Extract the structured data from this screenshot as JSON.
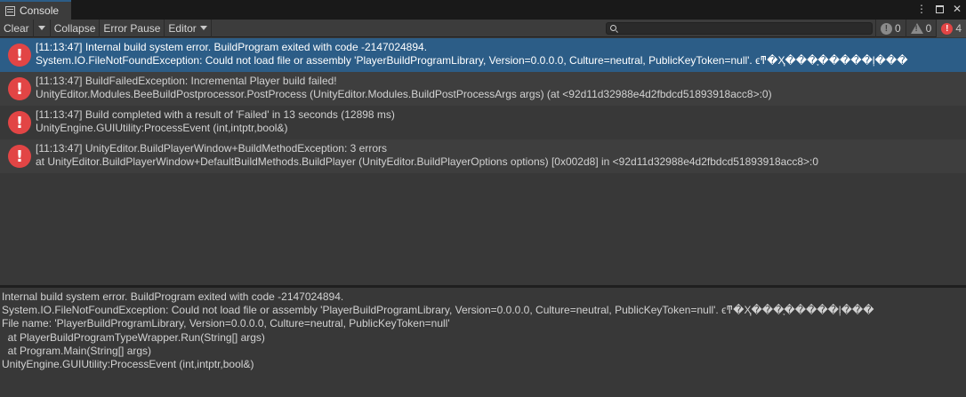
{
  "window": {
    "tab_label": "Console",
    "controls": {
      "menu": "⋮",
      "close": "✕"
    }
  },
  "toolbar": {
    "clear_label": "Clear",
    "collapse_label": "Collapse",
    "error_pause_label": "Error Pause",
    "editor_label": "Editor",
    "search": {
      "value": "",
      "placeholder": ""
    },
    "counters": {
      "info_count": "0",
      "warning_count": "0",
      "error_count": "4"
    }
  },
  "logs": [
    {
      "line1": "[11:13:47] Internal build system error. BuildProgram exited with code -2147024894.",
      "line2": "System.IO.FileNotFoundException: Could not load file or assembly 'PlayerBuildProgramLibrary, Version=0.0.0.0, Culture=neutral, PublicKeyToken=null'. ϵͳ�Ҳ���ָ�����ļ���"
    },
    {
      "line1": "[11:13:47] BuildFailedException: Incremental Player build failed!",
      "line2": "UnityEditor.Modules.BeeBuildPostprocessor.PostProcess (UnityEditor.Modules.BuildPostProcessArgs args) (at <92d11d32988e4d2fbdcd51893918acc8>:0)"
    },
    {
      "line1": "[11:13:47] Build completed with a result of 'Failed' in 13 seconds (12898 ms)",
      "line2": "UnityEngine.GUIUtility:ProcessEvent (int,intptr,bool&)"
    },
    {
      "line1": "[11:13:47] UnityEditor.BuildPlayerWindow+BuildMethodException: 3 errors",
      "line2": "  at UnityEditor.BuildPlayerWindow+DefaultBuildMethods.BuildPlayer (UnityEditor.BuildPlayerOptions options) [0x002d8] in <92d11d32988e4d2fbdcd51893918acc8>:0"
    }
  ],
  "detail": {
    "lines": [
      "Internal build system error. BuildProgram exited with code -2147024894.",
      "System.IO.FileNotFoundException: Could not load file or assembly 'PlayerBuildProgramLibrary, Version=0.0.0.0, Culture=neutral, PublicKeyToken=null'. ϵͳ�Ҳ���ָ�����ļ���",
      "File name: 'PlayerBuildProgramLibrary, Version=0.0.0.0, Culture=neutral, PublicKeyToken=null'",
      "  at PlayerBuildProgramTypeWrapper.Run(String[] args)",
      "  at Program.Main(String[] args)",
      "UnityEngine.GUIUtility:ProcessEvent (int,intptr,bool&)"
    ]
  },
  "colors": {
    "selection": "#2c5d87",
    "error": "#e24545",
    "panel": "#383838"
  }
}
